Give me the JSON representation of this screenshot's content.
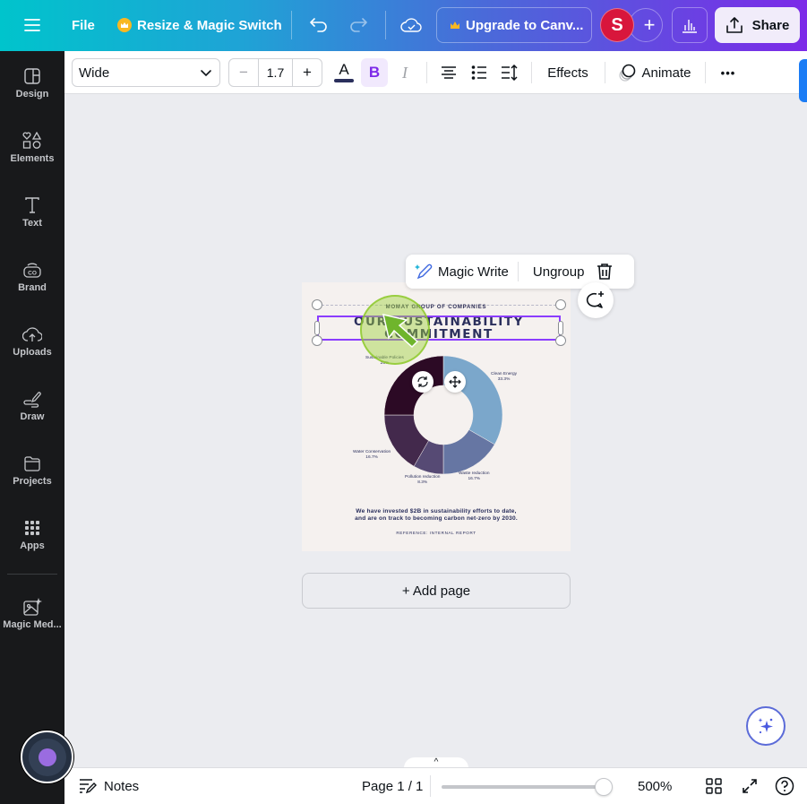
{
  "topbar": {
    "menu_icon": "hamburger-icon",
    "file_label": "File",
    "resize_label": "Resize & Magic Switch",
    "upgrade_label": "Upgrade to Canv...",
    "avatar_initial": "S",
    "share_label": "Share",
    "brand_gradient": [
      "#00c4cc",
      "#7c2ae8"
    ],
    "avatar_color": "#d8163c"
  },
  "sidebar": {
    "items": [
      {
        "label": "Design",
        "icon": "design-icon"
      },
      {
        "label": "Elements",
        "icon": "elements-icon"
      },
      {
        "label": "Text",
        "icon": "text-icon"
      },
      {
        "label": "Brand",
        "icon": "brand-icon"
      },
      {
        "label": "Uploads",
        "icon": "uploads-icon"
      },
      {
        "label": "Draw",
        "icon": "draw-icon"
      },
      {
        "label": "Projects",
        "icon": "folder-icon"
      },
      {
        "label": "Apps",
        "icon": "apps-icon"
      },
      {
        "label": "Magic Med...",
        "icon": "magic-media-icon"
      }
    ]
  },
  "toolbar": {
    "font_name": "Wide",
    "font_size": "1.7",
    "minus": "−",
    "plus": "+",
    "bold_label": "B",
    "italic_label": "I",
    "color_label": "A",
    "text_color": "#2a2f5c",
    "effects_label": "Effects",
    "animate_label": "Animate",
    "more_label": "•••"
  },
  "context_menu": {
    "magic_write_label": "Magic Write",
    "ungroup_label": "Ungroup"
  },
  "design": {
    "company": "MOMAY GROUP OF COMPANIES",
    "headline_line1": "OUR SUSTAINABILITY",
    "headline_line2": "COMMITMENT",
    "body_line1": "We have invested $2B in sustainability efforts to date,",
    "body_line2": "and are on track to becoming carbon net-zero by 2030.",
    "reference": "REFERENCE: INTERNAL REPORT"
  },
  "chart_data": {
    "type": "pie",
    "subtype": "donut",
    "title": "",
    "categories": [
      "Clean Energy",
      "Waste reduction",
      "Pollution reduction",
      "Water Conservation",
      "Sustainable Policies"
    ],
    "values": [
      33.3,
      16.7,
      8.3,
      16.7,
      25.0
    ],
    "value_labels": [
      "33.3%",
      "16.7%",
      "8.3%",
      "16.7%",
      "25%"
    ],
    "colors": [
      "#7ba7cb",
      "#6676a3",
      "#564a74",
      "#43294c",
      "#2c0a25"
    ],
    "start_angle_deg": 0,
    "direction": "clockwise"
  },
  "canvas": {
    "add_page_label": "+ Add page"
  },
  "footer": {
    "notes_label": "Notes",
    "page_indicator": "Page 1 / 1",
    "zoom_level": "500%",
    "zoom_fraction": 0.95,
    "collapse_label": "^"
  }
}
